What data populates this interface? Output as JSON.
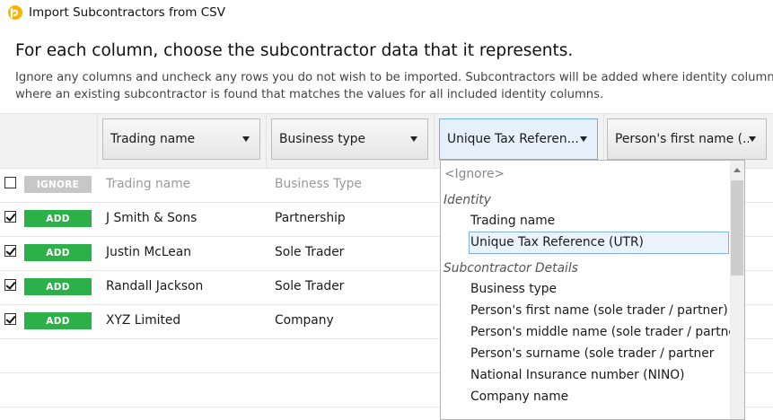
{
  "window": {
    "title": "Import Subcontractors from CSV",
    "icon": "app-logo-icon",
    "accent": "#f5b400"
  },
  "intro": {
    "heading": "For each column, choose the subcontractor data that it represents.",
    "desc_line1": "Ignore any columns and uncheck any rows you do not wish to be imported. Subcontractors will be added where identity column",
    "desc_line2": "where an existing subcontractor is found that matches the values for all included identity columns."
  },
  "columns": [
    {
      "label": "Trading name",
      "open": false
    },
    {
      "label": "Business type",
      "open": false
    },
    {
      "label": "Unique Tax Referen...",
      "open": true
    },
    {
      "label": "Person's first name (..."
    }
  ],
  "rows": [
    {
      "checked": false,
      "action": "IGNORE",
      "trading_name": "Trading name",
      "business_type": "Business Type",
      "header_row": true
    },
    {
      "checked": true,
      "action": "ADD",
      "trading_name": "J Smith & Sons",
      "business_type": "Partnership"
    },
    {
      "checked": true,
      "action": "ADD",
      "trading_name": "Justin McLean",
      "business_type": "Sole Trader"
    },
    {
      "checked": true,
      "action": "ADD",
      "trading_name": "Randall Jackson",
      "business_type": "Sole Trader"
    },
    {
      "checked": true,
      "action": "ADD",
      "trading_name": "XYZ Limited",
      "business_type": "Company"
    }
  ],
  "dropdown": {
    "ignore": "<Ignore>",
    "group_identity": "Identity",
    "identity_options": [
      "Trading name",
      "Unique Tax Reference (UTR)"
    ],
    "selected": "Unique Tax Reference (UTR)",
    "group_details": "Subcontractor Details",
    "detail_options": [
      "Business type",
      "Person's first name (sole trader / partner)",
      "Person's middle name (sole trader / partner",
      "Person's surname (sole trader / partner",
      "National Insurance number (NINO)",
      "Company name"
    ]
  },
  "colors": {
    "add": "#2db04a",
    "ignore": "#c7c7c7",
    "active_border": "#73aee8"
  }
}
